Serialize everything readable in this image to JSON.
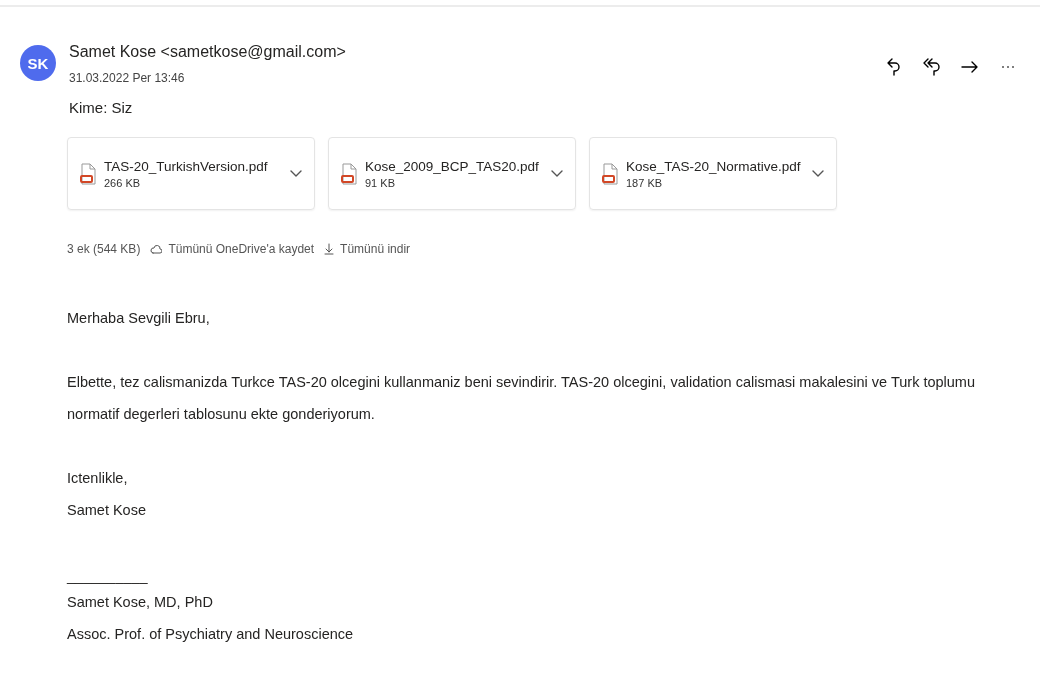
{
  "sender": {
    "initials": "SK",
    "name": "Samet Kose <sametkose@gmail.com>",
    "date": "31.03.2022 Per 13:46",
    "to": "Kime: Siz"
  },
  "attachments": [
    {
      "name": "TAS-20_TurkishVersion.pdf",
      "size": "266 KB"
    },
    {
      "name": "Kose_2009_BCP_TAS20.pdf",
      "size": "91 KB"
    },
    {
      "name": "Kose_TAS-20_Normative.pdf",
      "size": "187 KB"
    }
  ],
  "attachment_summary": {
    "count": "3 ek (544 KB)",
    "save_all": "Tümünü OneDrive'a kaydet",
    "download_all": "Tümünü indir"
  },
  "body": {
    "greeting": "Merhaba Sevgili Ebru,",
    "paragraph": "Elbette, tez calismanizda Turkce TAS-20 olcegini kullanmaniz beni sevindirir. TAS-20 olcegini, validation calismasi makalesini ve Turk toplumu normatif degerleri tablosunu ekte gonderiyorum.",
    "closing": [
      "Ictenlikle,",
      "Samet Kose"
    ],
    "signature_separator": "__________",
    "signature": [
      "Samet Kose, MD, PhD",
      "Assoc. Prof. of Psychiatry and Neuroscience"
    ]
  }
}
